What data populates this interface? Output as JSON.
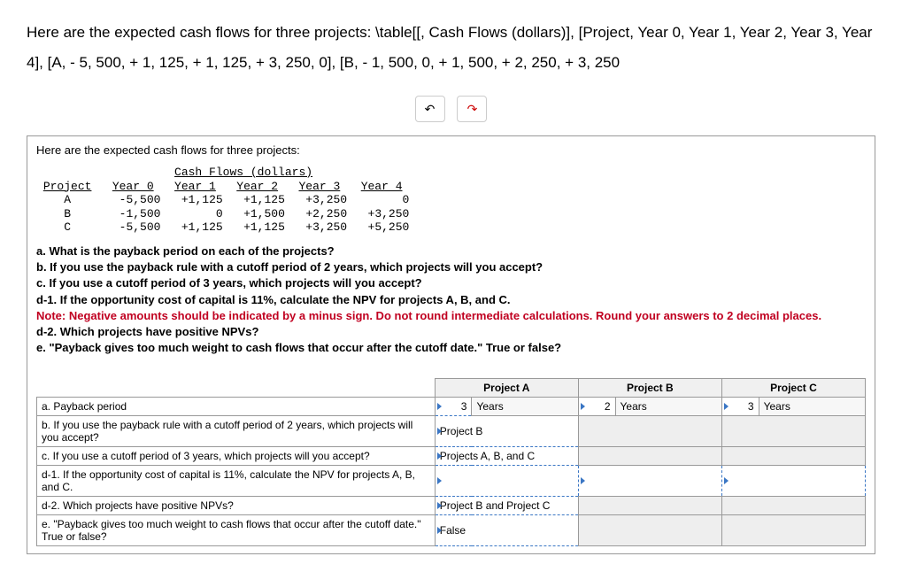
{
  "problem": {
    "text": "Here are the expected cash flows for three projects: \\table[[, Cash Flows (dollars)], [Project, Year 0, Year 1, Year 2, Year 3, Year 4], [A, - 5, 500, + 1, 125, + 1, 125, + 3, 250, 0], [B, - 1, 500, 0, + 1, 500, + 2, 250, + 3, 250"
  },
  "toolbar": {
    "undo": "↶",
    "redo": "↷"
  },
  "content": {
    "intro": "Here are the expected cash flows for three projects:",
    "table_header": "Cash Flows (dollars)",
    "cols": [
      "Project",
      "Year 0",
      "Year 1",
      "Year 2",
      "Year 3",
      "Year 4"
    ],
    "rows": [
      {
        "p": "A",
        "y0": "-5,500",
        "y1": "+1,125",
        "y2": "+1,125",
        "y3": "+3,250",
        "y4": "0"
      },
      {
        "p": "B",
        "y0": "-1,500",
        "y1": "0",
        "y2": "+1,500",
        "y3": "+2,250",
        "y4": "+3,250"
      },
      {
        "p": "C",
        "y0": "-5,500",
        "y1": "+1,125",
        "y2": "+1,125",
        "y3": "+3,250",
        "y4": "+5,250"
      }
    ],
    "q_a": "a. What is the payback period on each of the projects?",
    "q_b": "b. If you use the payback rule with a cutoff period of 2 years, which projects will you accept?",
    "q_c": "c. If you use a cutoff period of 3 years, which projects will you accept?",
    "q_d1": "d-1. If the opportunity cost of capital is 11%, calculate the NPV for projects A, B, and C.",
    "note": "Note: Negative amounts should be indicated by a minus sign. Do not round intermediate calculations. Round your answers to 2 decimal places.",
    "q_d2": "d-2. Which projects have positive NPVs?",
    "q_e": "e. \"Payback gives too much weight to cash flows that occur after the cutoff date.\" True or false?"
  },
  "answers": {
    "headers": {
      "projA": "Project A",
      "projB": "Project B",
      "projC": "Project C"
    },
    "rows": {
      "a": {
        "label": "a. Payback period",
        "valA": "3",
        "unitA": "Years",
        "valB": "2",
        "unitB": "Years",
        "valC": "3",
        "unitC": "Years"
      },
      "b": {
        "label": "b. If you use the payback rule with a cutoff period of 2 years, which projects will you accept?",
        "val": "Project B"
      },
      "c": {
        "label": "c. If you use a cutoff period of 3 years, which projects will you accept?",
        "val": "Projects A, B, and C"
      },
      "d1": {
        "label": "d-1. If the opportunity cost of capital is 11%, calculate the NPV for projects A, B, and C.",
        "valA": "",
        "valB": "",
        "valC": ""
      },
      "d2": {
        "label": "d-2. Which projects have positive NPVs?",
        "val": "Project B and Project C"
      },
      "e": {
        "label": "e. \"Payback gives too much weight to cash flows that occur after the cutoff date.\" True or false?",
        "val": "False"
      }
    }
  }
}
